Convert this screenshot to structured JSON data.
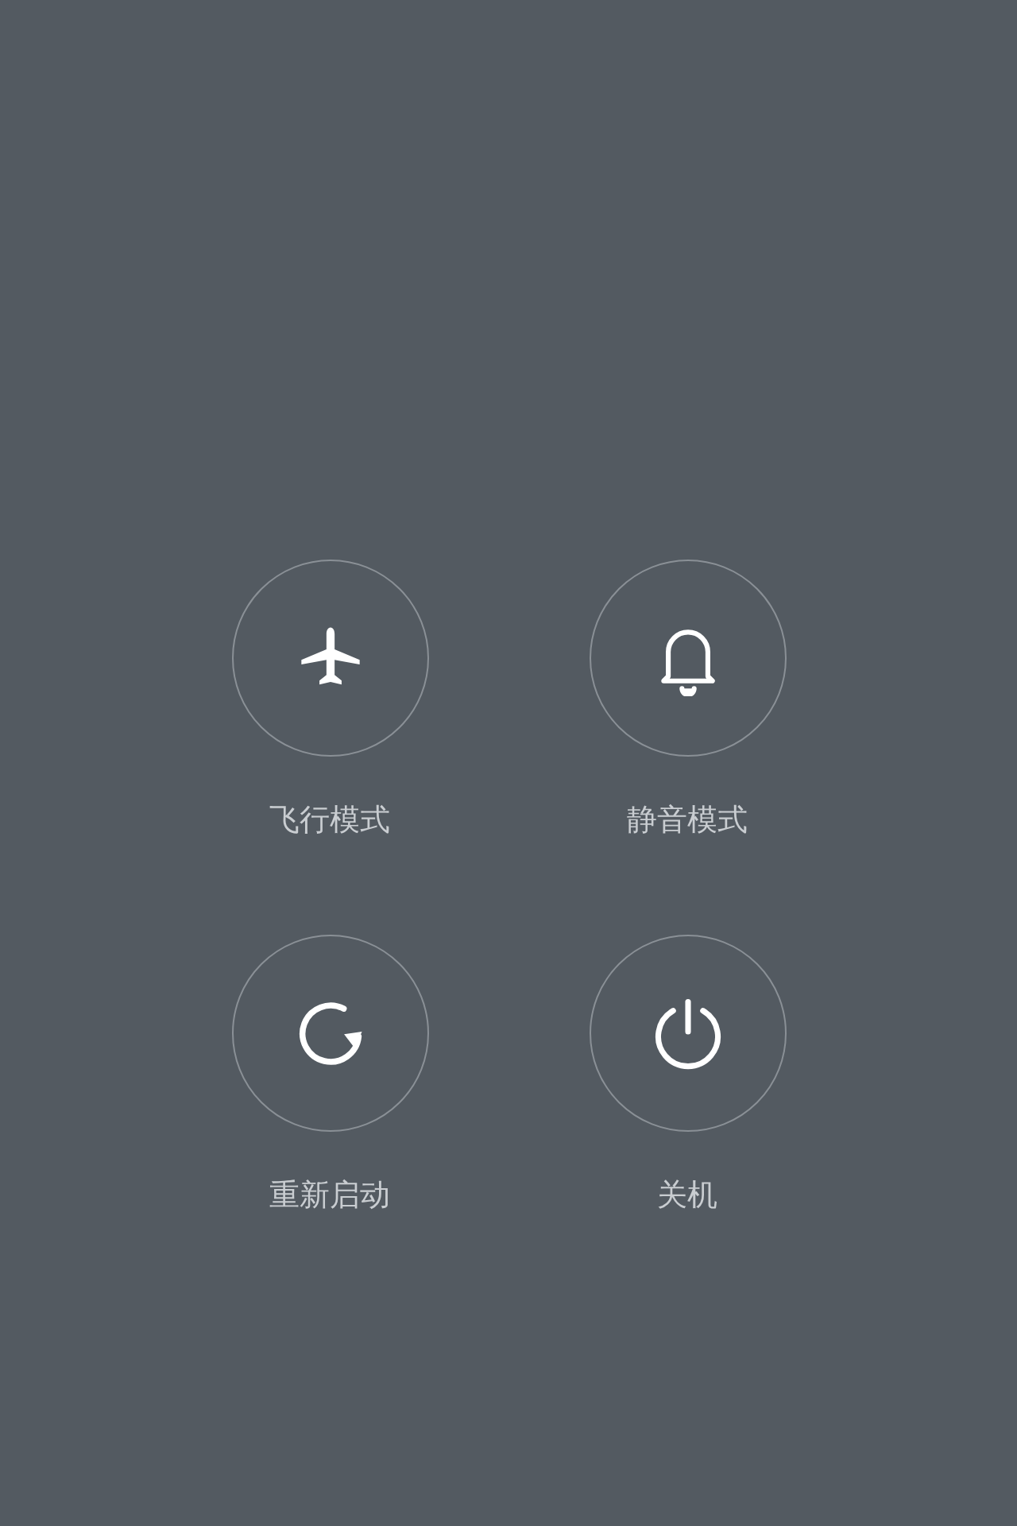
{
  "actions": [
    {
      "kind": "airplane",
      "label": "飞行模式"
    },
    {
      "kind": "silent",
      "label": "静音模式"
    },
    {
      "kind": "restart",
      "label": "重新启动"
    },
    {
      "kind": "power",
      "label": "关机"
    }
  ]
}
